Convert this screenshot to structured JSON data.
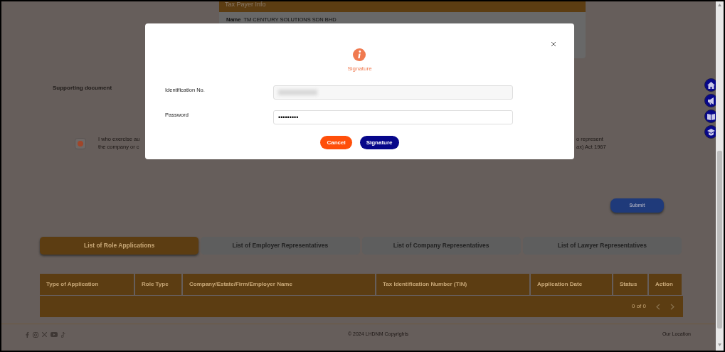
{
  "taxpayer_info": {
    "title": "Tax Payer Info",
    "name_label": "Name",
    "name_value": "TM CENTURY SOLUTIONS SDN BHD"
  },
  "supporting_document": {
    "label": "Supporting document"
  },
  "declaration": {
    "checked": true,
    "left_lines": [
      "I who exercise au",
      "the company or c"
    ],
    "right_lines": [
      "o represent",
      "ax) Act 1967"
    ]
  },
  "submit_button": "Submit",
  "tabs": [
    {
      "label": "List of Role Applications",
      "selected": true
    },
    {
      "label": "List of Employer Representatives",
      "selected": false
    },
    {
      "label": "List of Company Representatives",
      "selected": false
    },
    {
      "label": "List of Lawyer Representatives",
      "selected": false
    }
  ],
  "table": {
    "columns": [
      "Type of Application",
      "Role Type",
      "Company/Estate/Firm/Employer Name",
      "Tax Identification Number (TIN)",
      "Application Date",
      "Status",
      "Action"
    ],
    "pagination": "0 of 0"
  },
  "footer": {
    "copyright": "© 2024 LHDNM Copyrights",
    "location_link": "Our Location"
  },
  "modal": {
    "title": "Signature",
    "fields": [
      {
        "label": "Identification No.",
        "kind": "redacted"
      },
      {
        "label": "Password",
        "kind": "password",
        "value": "•••••••••"
      }
    ],
    "buttons": [
      {
        "label": "Cancel",
        "kind": "cancel"
      },
      {
        "label": "Signature",
        "kind": "primary"
      }
    ]
  }
}
